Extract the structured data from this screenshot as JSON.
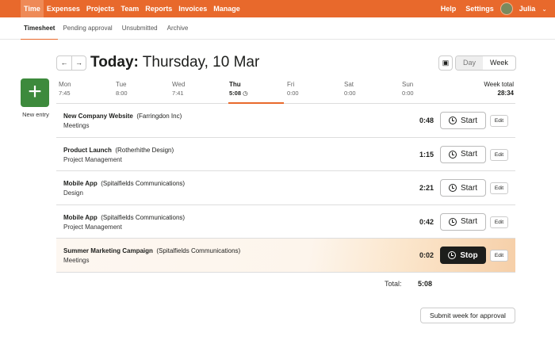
{
  "topnav": {
    "items": [
      "Time",
      "Expenses",
      "Projects",
      "Team",
      "Reports",
      "Invoices",
      "Manage"
    ],
    "help": "Help",
    "settings": "Settings",
    "user": "Julia"
  },
  "subnav": [
    "Timesheet",
    "Pending approval",
    "Unsubmitted",
    "Archive"
  ],
  "header": {
    "prev": "←",
    "next": "→",
    "title_bold": "Today:",
    "title_rest": " Thursday, 10 Mar",
    "view_day": "Day",
    "view_week": "Week"
  },
  "new_entry": {
    "label": "New entry"
  },
  "days": [
    {
      "name": "Mon",
      "time": "7:45"
    },
    {
      "name": "Tue",
      "time": "8:00"
    },
    {
      "name": "Wed",
      "time": "7:41"
    },
    {
      "name": "Thu",
      "time": "5:08"
    },
    {
      "name": "Fri",
      "time": "0:00"
    },
    {
      "name": "Sat",
      "time": "0:00"
    },
    {
      "name": "Sun",
      "time": "0:00"
    }
  ],
  "week_total": {
    "label": "Week total",
    "value": "28:34"
  },
  "entries": [
    {
      "project": "New Company Website",
      "client": "(Farringdon Inc)",
      "task": "Meetings",
      "duration": "0:48",
      "action": "Start",
      "edit": "Edit"
    },
    {
      "project": "Product Launch",
      "client": "(Rotherhithe Design)",
      "task": "Project Management",
      "duration": "1:15",
      "action": "Start",
      "edit": "Edit"
    },
    {
      "project": "Mobile App",
      "client": "(Spitalfields Communications)",
      "task": "Design",
      "duration": "2:21",
      "action": "Start",
      "edit": "Edit"
    },
    {
      "project": "Mobile App",
      "client": "(Spitalfields Communications)",
      "task": "Project Management",
      "duration": "0:42",
      "action": "Start",
      "edit": "Edit"
    },
    {
      "project": "Summer Marketing Campaign",
      "client": "(Spitalfields Communications)",
      "task": "Meetings",
      "duration": "0:02",
      "action": "Stop",
      "edit": "Edit"
    }
  ],
  "total": {
    "label": "Total:",
    "value": "5:08"
  },
  "submit": "Submit week for approval",
  "colors": {
    "brand": "#e8692c",
    "new_entry": "#3d8a3c"
  }
}
